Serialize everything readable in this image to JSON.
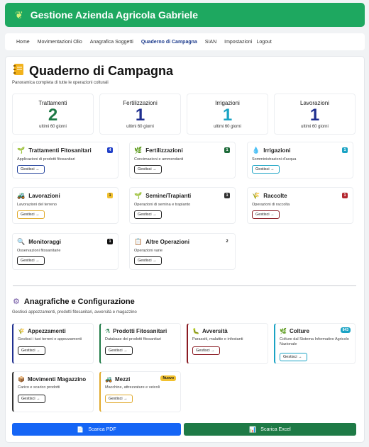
{
  "header": {
    "logo_icon": "wheat-icon",
    "title": "Gestione Azienda Agricola Gabriele"
  },
  "nav": [
    {
      "label": "Home"
    },
    {
      "label": "Movimentazioni Olio"
    },
    {
      "label": "Anagrafica Soggetti"
    },
    {
      "label": "Quaderno di Campagna",
      "active": true
    },
    {
      "label": "SIAN"
    },
    {
      "label": "Impostazioni"
    },
    {
      "label": "Logout"
    }
  ],
  "page": {
    "icon": "notebook-icon",
    "title": "Quaderno di Campagna",
    "subtitle": "Panoramica completa di tutte le operazioni colturali"
  },
  "stats": [
    {
      "label": "Trattamenti",
      "value": "2",
      "period": "ultimi 60 giorni",
      "color": "#1e7a46"
    },
    {
      "label": "Fertilizzazioni",
      "value": "1",
      "period": "ultimi 60 giorni",
      "color": "#1f2f8f"
    },
    {
      "label": "Irrigazioni",
      "value": "1",
      "period": "ultimi 60 giorni",
      "color": "#1aa3c4"
    },
    {
      "label": "Lavorazioni",
      "value": "1",
      "period": "ultimi 60 giorni",
      "color": "#1f2f8f"
    }
  ],
  "operations": [
    {
      "name": "Trattamenti Fitosanitari",
      "desc": "Applicazioni di prodotti fitosanitari",
      "badge": "4",
      "badge_color": "#2140c8",
      "btn": "Gestisci →",
      "btn_color": "#1f3f9a",
      "icon": "seedling-icon"
    },
    {
      "name": "Fertilizzazioni",
      "desc": "Concimazioni e ammendanti",
      "badge": "1",
      "badge_color": "#1e6b3a",
      "btn": "Gestisci →",
      "btn_color": "#222222",
      "icon": "sprout-icon"
    },
    {
      "name": "Irrigazioni",
      "desc": "Somministrazioni d'acqua",
      "badge": "1",
      "badge_color": "#1aa3c4",
      "btn": "Gestisci →",
      "btn_color": "#1aa3c4",
      "icon": "droplet-icon"
    },
    {
      "name": "Lavorazioni",
      "desc": "Lavorazioni del terreno",
      "badge": "1",
      "badge_color": "#f2c12e",
      "btn": "Gestisci →",
      "btn_color": "#e0a92a",
      "icon": "tractor-icon"
    },
    {
      "name": "Semine/Trapianti",
      "desc": "Operazioni di semina e trapianto",
      "badge": "1",
      "badge_color": "#333333",
      "btn": "Gestisci →",
      "btn_color": "#222222",
      "icon": "sprout-icon"
    },
    {
      "name": "Raccolte",
      "desc": "Operazioni di raccolta",
      "badge": "1",
      "badge_color": "#b3262e",
      "btn": "Gestisci →",
      "btn_color": "#8a1a22",
      "icon": "wheat-icon"
    },
    {
      "name": "Monitoraggi",
      "desc": "Osservazioni fitosanitarie",
      "badge": "1",
      "badge_color": "#111111",
      "btn": "Gestisci →",
      "btn_color": "#222222",
      "icon": "magnifier-icon"
    },
    {
      "name": "Altre Operazioni",
      "desc": "Operazioni varie",
      "badge": "2",
      "badge_color": "#ffffff",
      "btn": "Gestisci →",
      "btn_color": "#222222",
      "icon": "clipboard-icon"
    }
  ],
  "config_section": {
    "icon": "gear-icon",
    "title": "Anagrafiche e Configurazione",
    "subtitle": "Gestisci appezzamenti, prodotti fitosanitari, avversità e magazzino"
  },
  "configs": [
    {
      "name": "Appezzamenti",
      "desc": "Gestisci i tuoi terreni e appezzamenti",
      "btn": "Gestisci →",
      "border": "#1f2f8f",
      "icon": "field-icon"
    },
    {
      "name": "Prodotti Fitosanitari",
      "desc": "Database dei prodotti fitosanitari",
      "btn": "Gestisci →",
      "border": "#1e7a46",
      "icon": "flask-icon"
    },
    {
      "name": "Avversità",
      "desc": "Parassiti, malattie e infestanti",
      "btn": "Gestisci →",
      "border": "#8a1a22",
      "icon": "bug-icon"
    },
    {
      "name": "Colture",
      "desc": "Colture dal Sistema Informativo Agricolo Nazionale",
      "btn": "Gestisci →",
      "border": "#1aa3c4",
      "badge": "843",
      "badge_bg": "#1aa3c4",
      "badge_fg": "#ffffff",
      "icon": "plant-icon"
    },
    {
      "name": "Movimenti Magazzino",
      "desc": "Carico e scarico prodotti",
      "btn": "Gestisci →",
      "border": "#333333",
      "icon": "box-icon"
    },
    {
      "name": "Mezzi",
      "desc": "Macchine, attrezzature e veicoli",
      "btn": "Gestisci →",
      "border": "#e0a92a",
      "badge": "Nuovo",
      "badge_bg": "#f2c12e",
      "badge_fg": "#222222",
      "icon": "tractor-icon"
    }
  ],
  "downloads": {
    "pdf": {
      "label": "Scarica PDF",
      "icon": "document-icon",
      "color": "#1565f5"
    },
    "excel": {
      "label": "Scarica Excel",
      "icon": "spreadsheet-icon",
      "color": "#1e7a46"
    }
  }
}
